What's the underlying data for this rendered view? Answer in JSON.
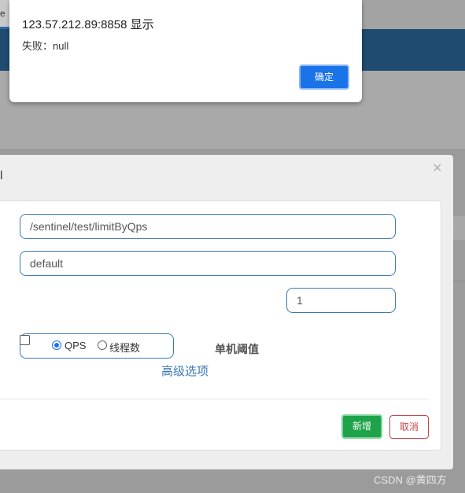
{
  "browser": {
    "tab_fragment": "e"
  },
  "alert": {
    "title": "123.57.212.89:8858 显示",
    "message": "失败：null",
    "ok_label": "确定"
  },
  "modal": {
    "title_fragment": "l",
    "close_glyph": "×",
    "resource_value": "/sentinel/test/limitByQps",
    "origin_value": "default",
    "threshold_type": {
      "options": [
        "QPS",
        "线程数"
      ],
      "selected": "QPS"
    },
    "threshold_label": "单机阈值",
    "threshold_value": "1",
    "advanced_link": "高级选项",
    "add_label": "新增",
    "cancel_label": "取消"
  },
  "watermark": "CSDN @黄四方",
  "colors": {
    "navbar": "#1f4b71",
    "primary": "#1a73e8",
    "success": "#1ea34a",
    "danger": "#c7454c",
    "link": "#3a78b7"
  }
}
